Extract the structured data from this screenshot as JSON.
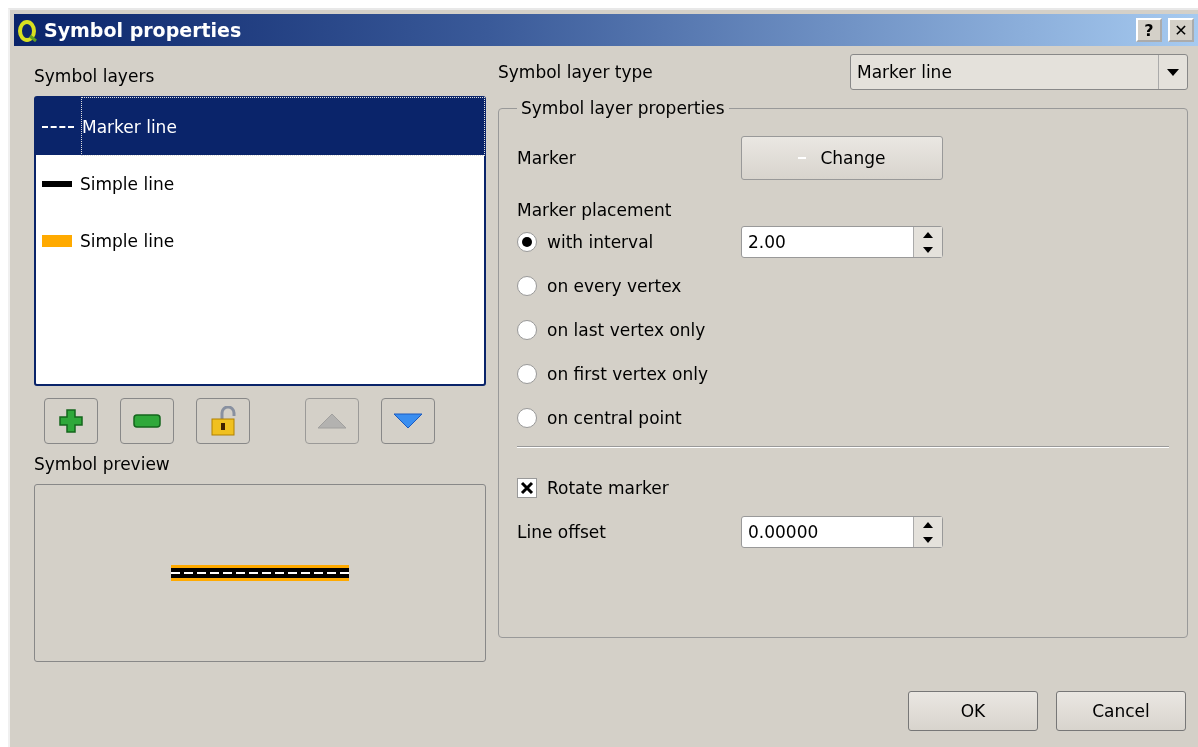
{
  "window": {
    "title": "Symbol properties",
    "help_button": "?",
    "close_button": "✕"
  },
  "symbol_layers": {
    "label": "Symbol layers",
    "items": [
      {
        "label": "Marker line",
        "kind": "marker",
        "color": "#ffffff",
        "selected": true
      },
      {
        "label": "Simple line",
        "kind": "line",
        "color": "#000000",
        "selected": false
      },
      {
        "label": "Simple line",
        "kind": "line",
        "color": "#ffaa00",
        "selected": false
      }
    ],
    "buttons": [
      {
        "kind": "add",
        "disabled": false
      },
      {
        "kind": "remove",
        "disabled": false
      },
      {
        "kind": "lock",
        "disabled": false
      },
      {
        "kind": "up",
        "disabled": true
      },
      {
        "kind": "down",
        "disabled": false
      }
    ]
  },
  "symbol_preview": {
    "label": "Symbol preview"
  },
  "layer_type": {
    "label": "Symbol layer type",
    "value": "Marker line"
  },
  "properties": {
    "title": "Symbol layer properties",
    "marker_label": "Marker",
    "change_button": "Change",
    "placement_label": "Marker placement",
    "placements": [
      {
        "label": "with interval",
        "selected": true,
        "value": "2.00"
      },
      {
        "label": "on every vertex",
        "selected": false
      },
      {
        "label": "on last vertex only",
        "selected": false
      },
      {
        "label": "on first vertex only",
        "selected": false
      },
      {
        "label": "on central point",
        "selected": false
      }
    ],
    "rotate": {
      "label": "Rotate marker",
      "checked": true
    },
    "offset": {
      "label": "Line offset",
      "value": "0.00000"
    }
  },
  "buttons": [
    "OK",
    "Cancel"
  ]
}
